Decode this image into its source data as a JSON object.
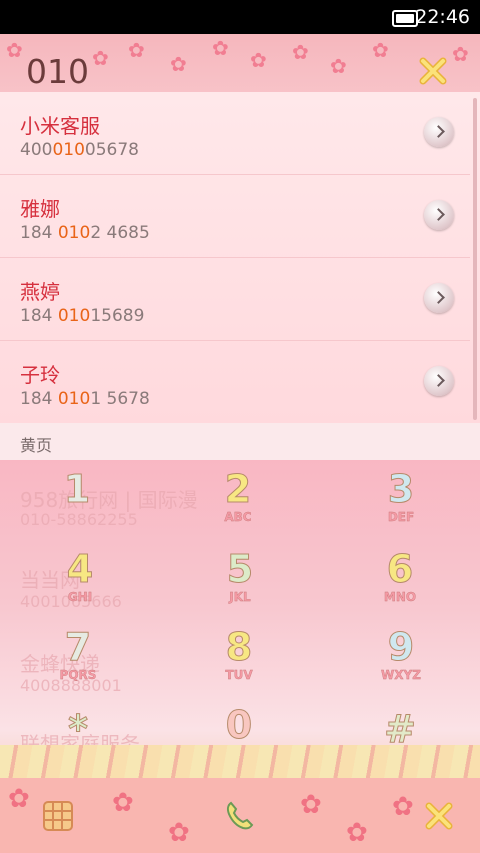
{
  "status_bar": {
    "time": "22:46",
    "battery_icon": "battery-icon"
  },
  "search": {
    "query": "010",
    "close_icon": "close-x-icon"
  },
  "results": [
    {
      "name": "小米客服",
      "number_prefix": "400",
      "number_match": "010",
      "number_suffix": "05678"
    },
    {
      "name": "雅娜",
      "number_prefix": "184 ",
      "number_match": "010",
      "number_suffix": "2 4685"
    },
    {
      "name": "燕婷",
      "number_prefix": "184 ",
      "number_match": "010",
      "number_suffix": "15689"
    },
    {
      "name": "子玲",
      "number_prefix": "184 ",
      "number_match": "010",
      "number_suffix": "1 5678"
    }
  ],
  "section_header": "黄页",
  "yellow_pages_behind": [
    {
      "name": "958旅行网 | 国际漫",
      "number": "010-58862255"
    },
    {
      "name": "当当网",
      "number": "4001065666"
    },
    {
      "name": "金蜂快递",
      "number": "4008888001"
    },
    {
      "name": "联想家庭服务"
    }
  ],
  "keypad": [
    {
      "digit": "1",
      "letters": ""
    },
    {
      "digit": "2",
      "letters": "ABC"
    },
    {
      "digit": "3",
      "letters": "DEF"
    },
    {
      "digit": "4",
      "letters": "GHI"
    },
    {
      "digit": "5",
      "letters": "JKL"
    },
    {
      "digit": "6",
      "letters": "MNO"
    },
    {
      "digit": "7",
      "letters": "PQRS"
    },
    {
      "digit": "8",
      "letters": "TUV"
    },
    {
      "digit": "9",
      "letters": "WXYZ"
    },
    {
      "digit": "*",
      "letters": ""
    },
    {
      "digit": "0",
      "letters": "+"
    },
    {
      "digit": "#",
      "letters": ""
    }
  ],
  "bottom_bar": {
    "keypad_icon": "dialpad-grid-icon",
    "call_icon": "phone-call-icon",
    "delete_icon": "close-x-icon"
  },
  "colors": {
    "accent_name": "#d6303e",
    "match_highlight": "#e96418",
    "header_bg": "#f6b7bd"
  }
}
